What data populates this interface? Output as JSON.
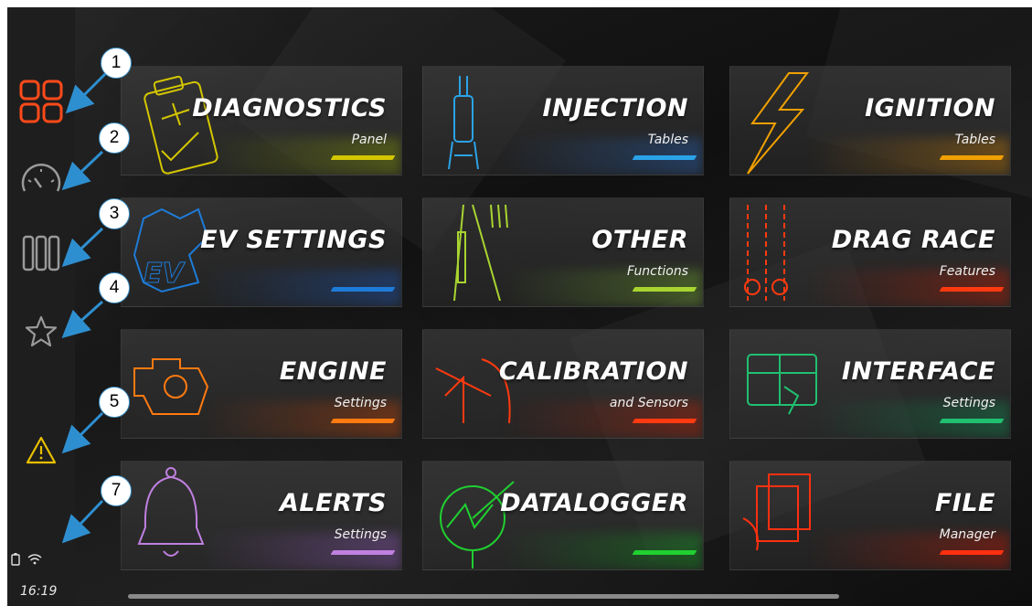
{
  "sidebar": {
    "items": [
      {
        "icon": "grid-icon",
        "active": true
      },
      {
        "icon": "gauge-icon"
      },
      {
        "icon": "columns-icon"
      },
      {
        "icon": "star-icon"
      },
      {
        "icon": "warning-icon"
      }
    ],
    "status": {
      "battery_icon": "battery-icon",
      "wifi_icon": "wifi-icon"
    },
    "clock": "16:19"
  },
  "callouts": [
    "1",
    "2",
    "3",
    "4",
    "5",
    "7"
  ],
  "tiles": [
    {
      "title": "DIAGNOSTICS",
      "subtitle": "Panel",
      "accent": "#d4c600",
      "glow": "#9ab000",
      "icon": "clipboard-icon"
    },
    {
      "title": "INJECTION",
      "subtitle": "Tables",
      "accent": "#2aa3e8",
      "glow": "#2a6fd0",
      "icon": "injector-icon"
    },
    {
      "title": "IGNITION",
      "subtitle": "Tables",
      "accent": "#f0a000",
      "glow": "#e08a00",
      "icon": "lightning-icon"
    },
    {
      "title": "EV SETTINGS",
      "subtitle": "",
      "accent": "#1e7bd8",
      "glow": "#1a5fd0",
      "icon": "ev-gear-icon"
    },
    {
      "title": "OTHER",
      "subtitle": "Functions",
      "accent": "#a8d430",
      "glow": "#80c030",
      "icon": "tools-icon"
    },
    {
      "title": "DRAG RACE",
      "subtitle": "Features",
      "accent": "#ff3a10",
      "glow": "#e02000",
      "icon": "drag-race-icon"
    },
    {
      "title": "ENGINE",
      "subtitle": "Settings",
      "accent": "#ff7a10",
      "glow": "#e04a00",
      "icon": "engine-icon"
    },
    {
      "title": "CALIBRATION",
      "subtitle": "and Sensors",
      "accent": "#ff3a10",
      "glow": "#d02000",
      "icon": "calibration-icon"
    },
    {
      "title": "INTERFACE",
      "subtitle": "Settings",
      "accent": "#20c070",
      "glow": "#10a060",
      "icon": "interface-icon"
    },
    {
      "title": "ALERTS",
      "subtitle": "Settings",
      "accent": "#c080e0",
      "glow": "#a060d0",
      "icon": "bell-icon"
    },
    {
      "title": "DATALOGGER",
      "subtitle": "",
      "accent": "#20d030",
      "glow": "#10b020",
      "icon": "datalogger-icon"
    },
    {
      "title": "FILE",
      "subtitle": "Manager",
      "accent": "#ff3010",
      "glow": "#e01a00",
      "icon": "file-icon"
    }
  ]
}
